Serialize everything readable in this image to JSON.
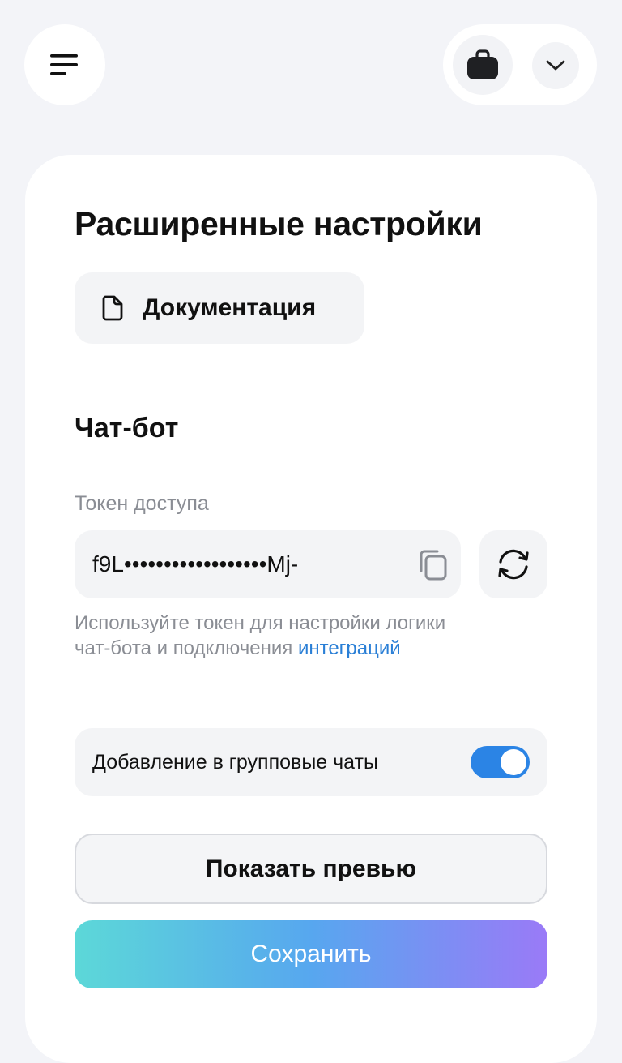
{
  "header": {
    "menu_icon": "menu-lines-icon",
    "bag_icon": "briefcase-icon",
    "chevron_icon": "chevron-down-icon"
  },
  "page": {
    "title": "Расширенные настройки",
    "documentation_label": "Документация",
    "documentation_icon": "document-icon"
  },
  "chatbot": {
    "section_title": "Чат-бот",
    "token_label": "Токен доступа",
    "token_value": "f9L••••••••••••••••••Mj-",
    "copy_icon": "copy-icon",
    "refresh_icon": "refresh-icon",
    "hint_text": "Используйте токен для настройки логики чат-бота и подключения",
    "hint_link": "интеграций",
    "group_chats_label": "Добавление в групповые чаты",
    "group_chats_enabled": true
  },
  "actions": {
    "preview_label": "Показать превью",
    "save_label": "Сохранить"
  },
  "colors": {
    "background": "#f3f4f8",
    "card": "#ffffff",
    "accent": "#2b84e5",
    "link": "#2a7fd6",
    "gradient_start": "#5cd8d8",
    "gradient_end": "#9a7af7"
  }
}
